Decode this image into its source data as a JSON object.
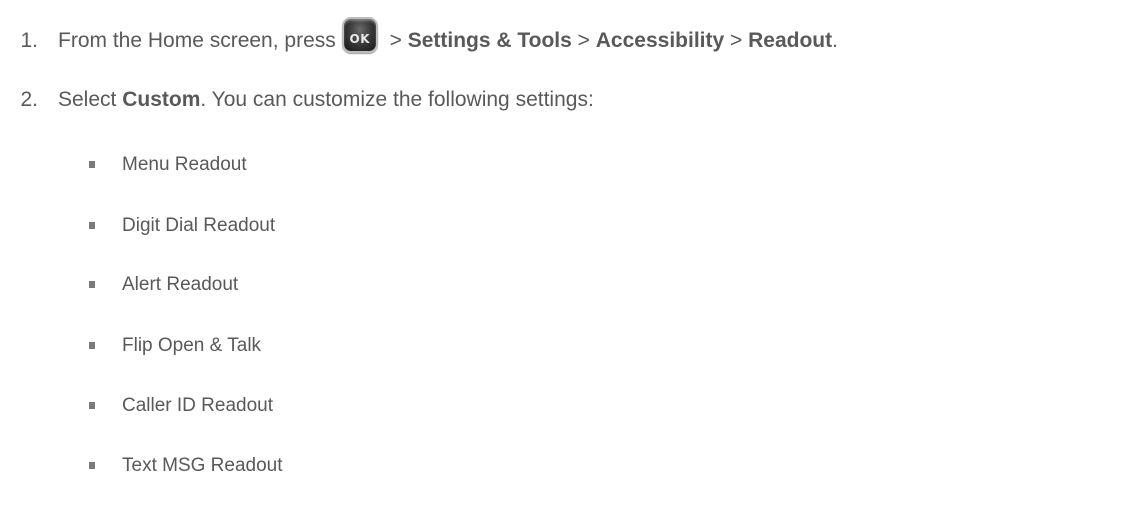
{
  "steps": [
    {
      "number": "1.",
      "intro": "From the Home screen, press",
      "key_icon": "ok-key-icon",
      "key_label": "OK",
      "sep1": " > ",
      "item1": "Settings & Tools",
      "sep2": " > ",
      "item2": "Accessibility",
      "sep3": " > ",
      "item3": "Readout",
      "end": "."
    },
    {
      "number": "2.",
      "intro": "Select ",
      "option": "Custom",
      "rest": ". You can customize the following settings:"
    }
  ],
  "settings_list": [
    "Menu Readout",
    "Digit Dial Readout",
    "Alert Readout",
    "Flip Open & Talk",
    "Caller ID Readout",
    "Text MSG Readout"
  ],
  "colors": {
    "text": "#595959",
    "bullet": "#7a7a7a",
    "key_face": "#3c3c3c"
  }
}
